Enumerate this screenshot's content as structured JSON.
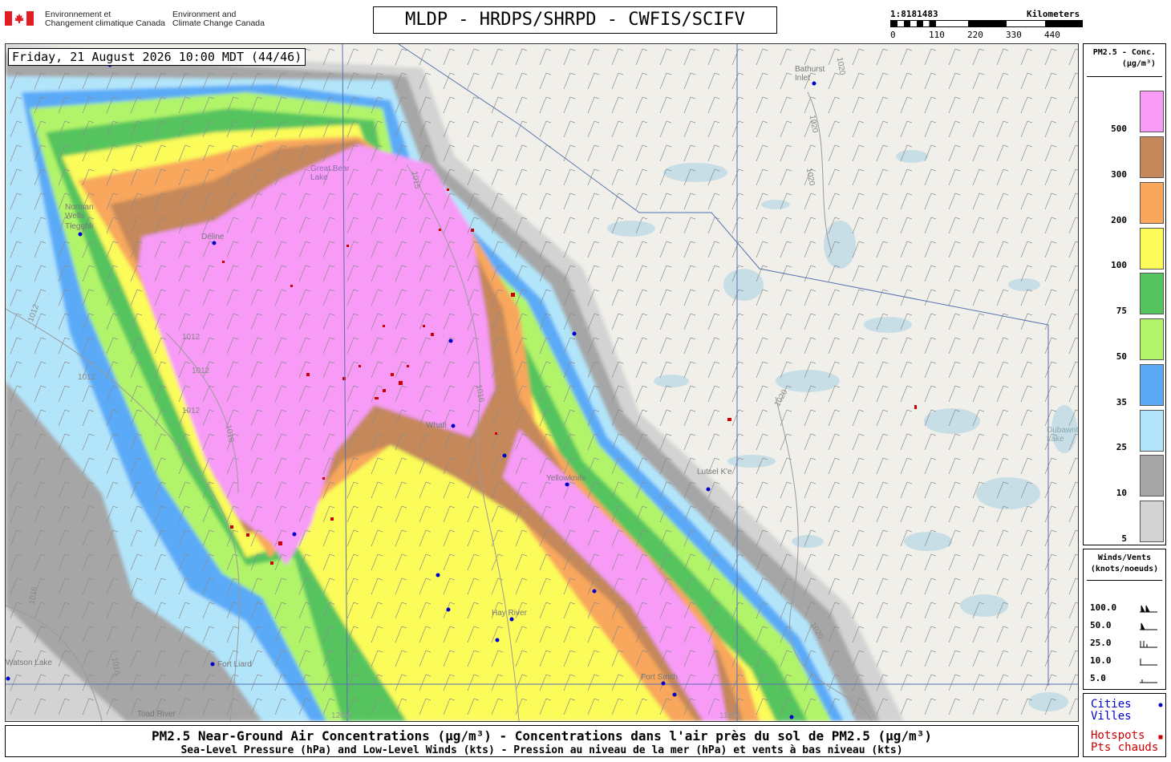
{
  "header": {
    "gov_fr": [
      "Environnement et",
      "Changement climatique Canada"
    ],
    "gov_en": [
      "Environment and",
      "Climate Change Canada"
    ],
    "title": "MLDP - HRDPS/SHRPD - CWFIS/SCIFV",
    "scale": {
      "ratio": "1:8181483",
      "unit": "Kilometers",
      "ticks": [
        "0",
        "110",
        "220",
        "330",
        "440"
      ]
    }
  },
  "map": {
    "datetime": "Friday, 21 August 2026 10:00 MDT (44/46)",
    "places": [
      {
        "name": "Norman\nWells",
        "label": "Norman Wells"
      },
      {
        "name": "Tłegǫhłı",
        "label": "Tlegohli"
      },
      {
        "name": "Déline",
        "label": "Deline"
      },
      {
        "name": "Great Bear Lake",
        "label": "Great Bear Lake"
      },
      {
        "name": "Whatì",
        "label": "Whati"
      },
      {
        "name": "Yellowknife",
        "label": "Yellowknife"
      },
      {
        "name": "Lutsel K'e",
        "label": "Lutsel K'e"
      },
      {
        "name": "Hay River",
        "label": "Hay River"
      },
      {
        "name": "Fort Liard",
        "label": "Fort Liard"
      },
      {
        "name": "Fort Smith",
        "label": "Fort Smith"
      },
      {
        "name": "Toad River",
        "label": "Toad River"
      },
      {
        "name": "Bathurst Inlet",
        "label": "Bathurst Inlet"
      },
      {
        "name": "Dubawnt Lake",
        "label": "Dubawnt Lake"
      },
      {
        "name": "Watson Lake",
        "label": "Watson Lake"
      }
    ],
    "isobars": [
      "1012",
      "1012",
      "1012",
      "1012",
      "1012",
      "1016",
      "1016",
      "1016",
      "1020",
      "1020",
      "1020",
      "1020",
      "1020",
      "1015",
      "1016"
    ],
    "meridians": [
      "120W",
      "110W"
    ]
  },
  "legend": {
    "title": [
      "PM2.5 - Conc.",
      "(µg/m³)"
    ],
    "levels": [
      {
        "label": "500",
        "color": "#f79bf7"
      },
      {
        "label": "300",
        "color": "#c4885a"
      },
      {
        "label": "200",
        "color": "#f8a75c"
      },
      {
        "label": "100",
        "color": "#fbfb5a"
      },
      {
        "label": "75",
        "color": "#55c45e"
      },
      {
        "label": "50",
        "color": "#b1f46b"
      },
      {
        "label": "35",
        "color": "#5aaaf8"
      },
      {
        "label": "25",
        "color": "#b3e5fa"
      },
      {
        "label": "10",
        "color": "#a6a6a6"
      },
      {
        "label": "5",
        "color": "#d3d3d3"
      }
    ]
  },
  "winds": {
    "title": [
      "Winds/Vents",
      "(knots/noeuds)"
    ],
    "speeds": [
      "100.0",
      "50.0",
      "25.0",
      "10.0",
      "5.0"
    ]
  },
  "key": {
    "cities": [
      "Cities",
      "Villes"
    ],
    "hotspots": [
      "Hotspots",
      "Pts chauds"
    ],
    "cities_color": "#0000cc",
    "hotspots_color": "#cc0000"
  },
  "footer": {
    "line1": "PM2.5 Near-Ground Air Concentrations (µg/m³) - Concentrations dans l'air près du sol de PM2.5 (µg/m³)",
    "line2": "Sea-Level Pressure (hPa) and Low-Level Winds (kts) - Pression au niveau de la mer (hPa) et vents à bas niveau (kts)"
  }
}
